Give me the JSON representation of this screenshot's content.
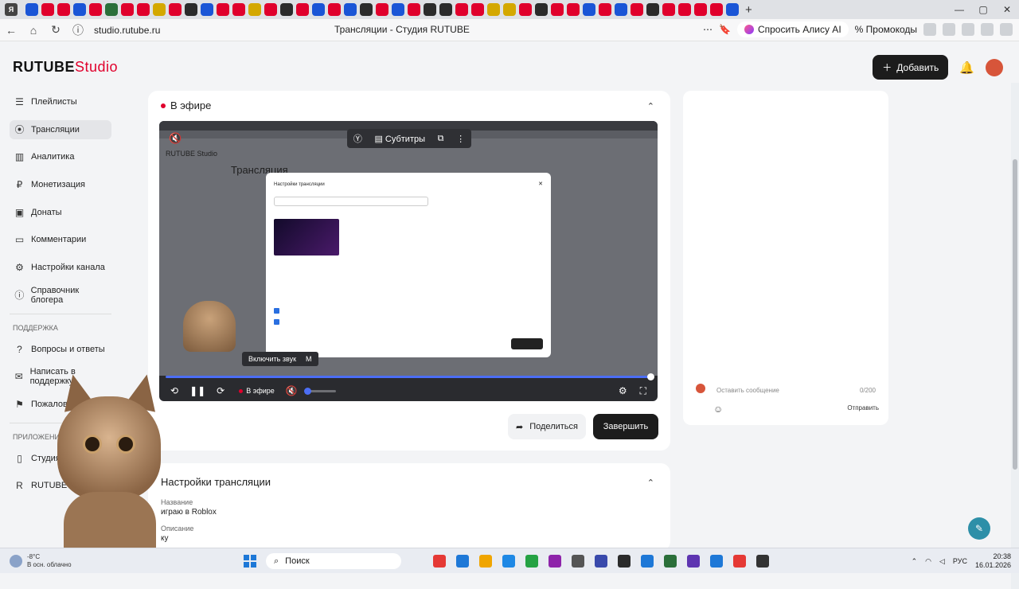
{
  "browser": {
    "url": "studio.rutube.ru",
    "page_title": "Трансляции - Студия RUTUBE",
    "alice_label": "Спросить Алису AI",
    "promo_label": "Промокоды"
  },
  "header": {
    "brand_main": "RUTUBE",
    "brand_studio": "Studio",
    "add_label": "Добавить"
  },
  "sidebar": {
    "items": [
      {
        "label": "Плейлисты"
      },
      {
        "label": "Трансляции"
      },
      {
        "label": "Аналитика"
      },
      {
        "label": "Монетизация"
      },
      {
        "label": "Донаты"
      },
      {
        "label": "Комментарии"
      },
      {
        "label": "Настройки канала"
      },
      {
        "label": "Справочник блогера"
      }
    ],
    "support_header": "Поддержка",
    "support_items": [
      {
        "label": "Вопросы и ответы"
      },
      {
        "label": "Написать в поддержку"
      },
      {
        "label": "Пожаловаться"
      }
    ],
    "apps_header": "Приложения",
    "apps_items": [
      {
        "label": "Студия RUTUBE"
      },
      {
        "label": "RUTUBE"
      }
    ]
  },
  "live": {
    "header": "В эфире",
    "player": {
      "subtitles_label": "Субтитры",
      "unmute_tip": "Включить звук",
      "unmute_key": "M",
      "live_badge": "В эфире",
      "inner_title": "Трансляция",
      "inner_brand": "RUTUBE Studio",
      "modal_title": "Настройки трансляции"
    },
    "share_label": "Поделиться",
    "end_label": "Завершить"
  },
  "settings": {
    "title": "Настройки трансляции",
    "name_label": "Название",
    "name_value": "играю в Roblox",
    "desc_label": "Описание",
    "desc_value": "ку"
  },
  "chat": {
    "placeholder": "Оставить сообщение",
    "counter": "0/200",
    "send_label": "Отправить"
  },
  "taskbar": {
    "temp": "-8°C",
    "weather_text": "В осн. облачно",
    "search_label": "Поиск",
    "lang": "РУС",
    "time": "20:38",
    "date": "16.01.2026"
  },
  "colors": {
    "accent": "#e0002c",
    "primary_button": "#1c1c1c",
    "progress": "#4c6ef5"
  }
}
